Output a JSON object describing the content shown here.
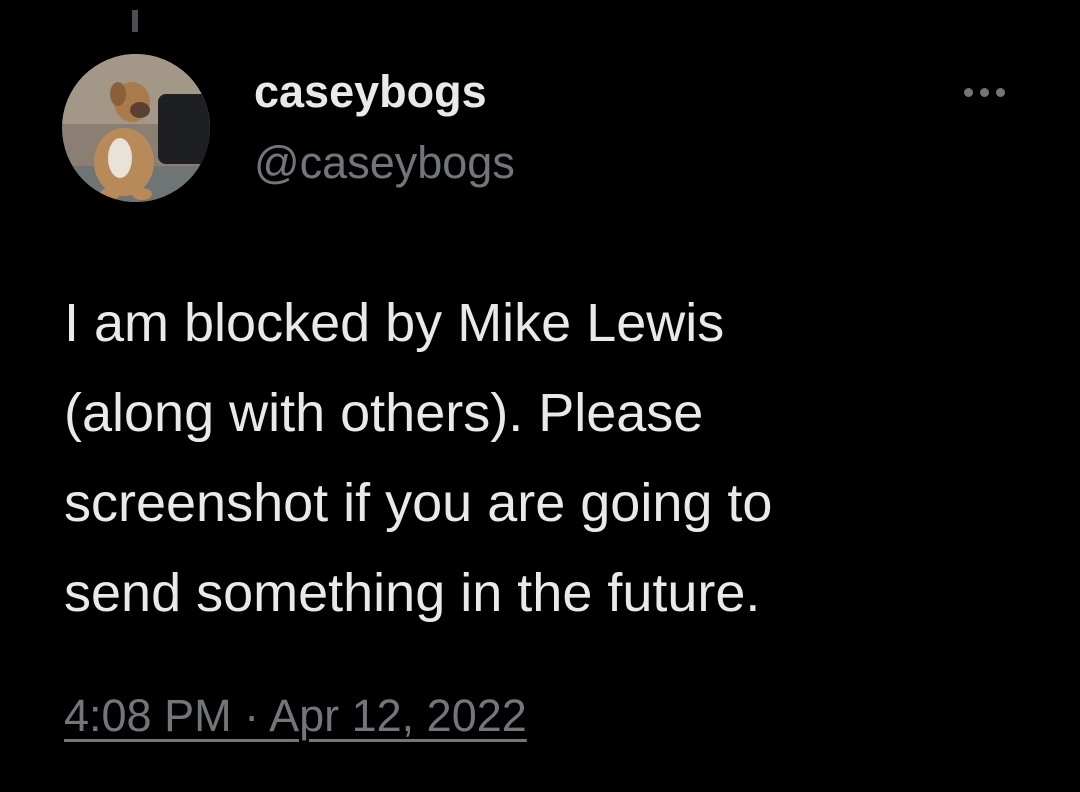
{
  "tweet": {
    "author": {
      "display_name": "caseybogs",
      "handle": "@caseybogs",
      "avatar_icon": "dog-photo-avatar"
    },
    "more_icon": "more-horizontal-icon",
    "text_lines": [
      "I am blocked by Mike Lewis",
      "(along with others). Please",
      "screenshot if you are going to",
      "send something in the future."
    ],
    "timestamp": "4:08 PM · Apr 12, 2022"
  },
  "colors": {
    "background": "#000000",
    "primary_text": "#e7e9ea",
    "secondary_text": "#71767b"
  }
}
